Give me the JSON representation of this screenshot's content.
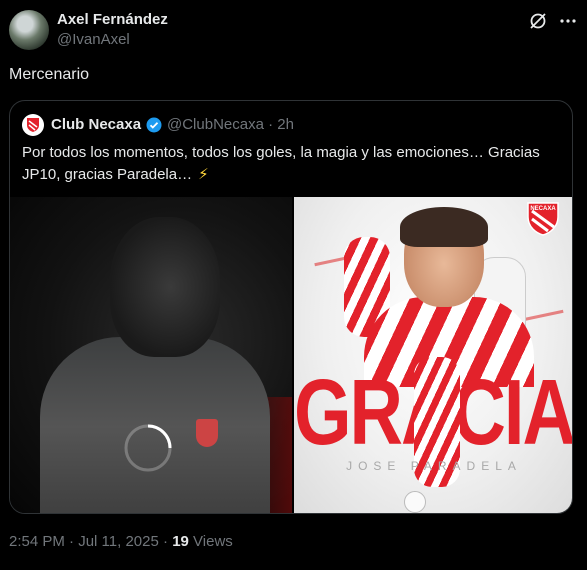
{
  "author": {
    "name": "Axel Fernández",
    "handle": "@IvanAxel"
  },
  "post": {
    "text": "Mercenario"
  },
  "quote": {
    "name": "Club Necaxa",
    "handle": "@ClubNecaxa",
    "separator": "·",
    "age": "2h",
    "text": "Por todos los momentos, todos los goles, la magia y las emociones… Gracias JP10, gracias Paradela…",
    "emoji": "⚡"
  },
  "media": {
    "image_title": "GRACIAS",
    "image_subtitle": "JOSE PARADELA",
    "crest_text": "NECAXA"
  },
  "meta": {
    "time": "2:54 PM",
    "dot": "·",
    "date": "Jul 11, 2025",
    "dot2": "·",
    "views_count": "19",
    "views_label": "Views"
  },
  "colors": {
    "accent": "#1d9bf0",
    "brand_red": "#e3222b",
    "muted": "#71767b"
  },
  "icons": {
    "grok": "grok-icon",
    "more": "more-icon",
    "verified": "verified-badge-icon",
    "pause": "pause-icon"
  }
}
